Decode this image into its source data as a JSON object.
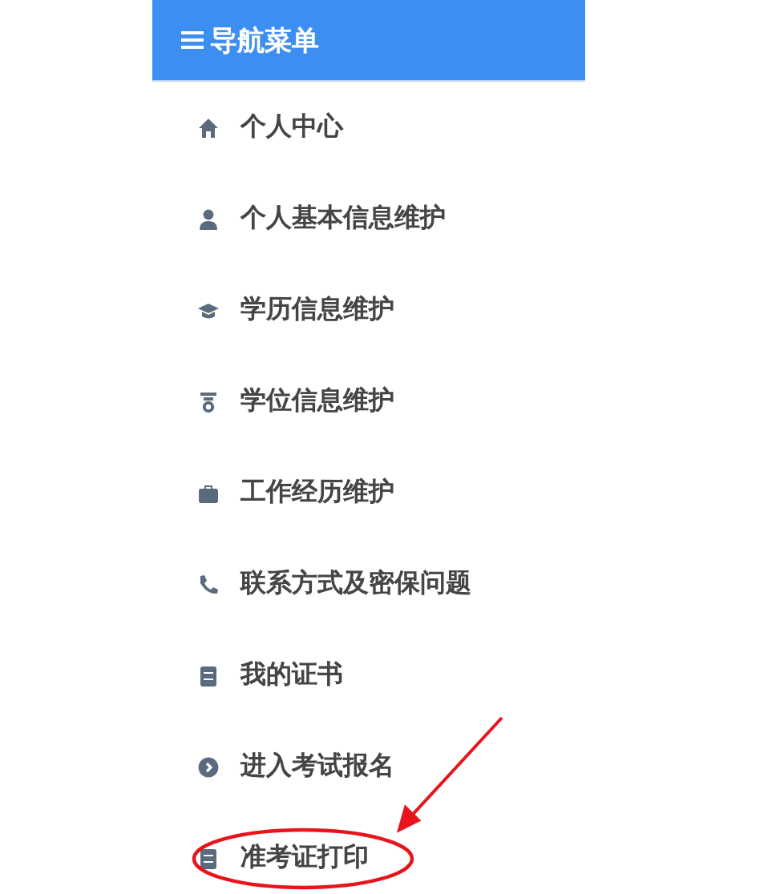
{
  "header": {
    "title": "导航菜单"
  },
  "menu": [
    {
      "label": "个人中心",
      "annotated": false
    },
    {
      "label": "个人基本信息维护",
      "annotated": false
    },
    {
      "label": "学历信息维护",
      "annotated": false
    },
    {
      "label": "学位信息维护",
      "annotated": false
    },
    {
      "label": "工作经历维护",
      "annotated": false
    },
    {
      "label": "联系方式及密保问题",
      "annotated": false
    },
    {
      "label": "我的证书",
      "annotated": false
    },
    {
      "label": "进入考试报名",
      "annotated": false
    },
    {
      "label": "准考证打印",
      "annotated": true
    }
  ]
}
